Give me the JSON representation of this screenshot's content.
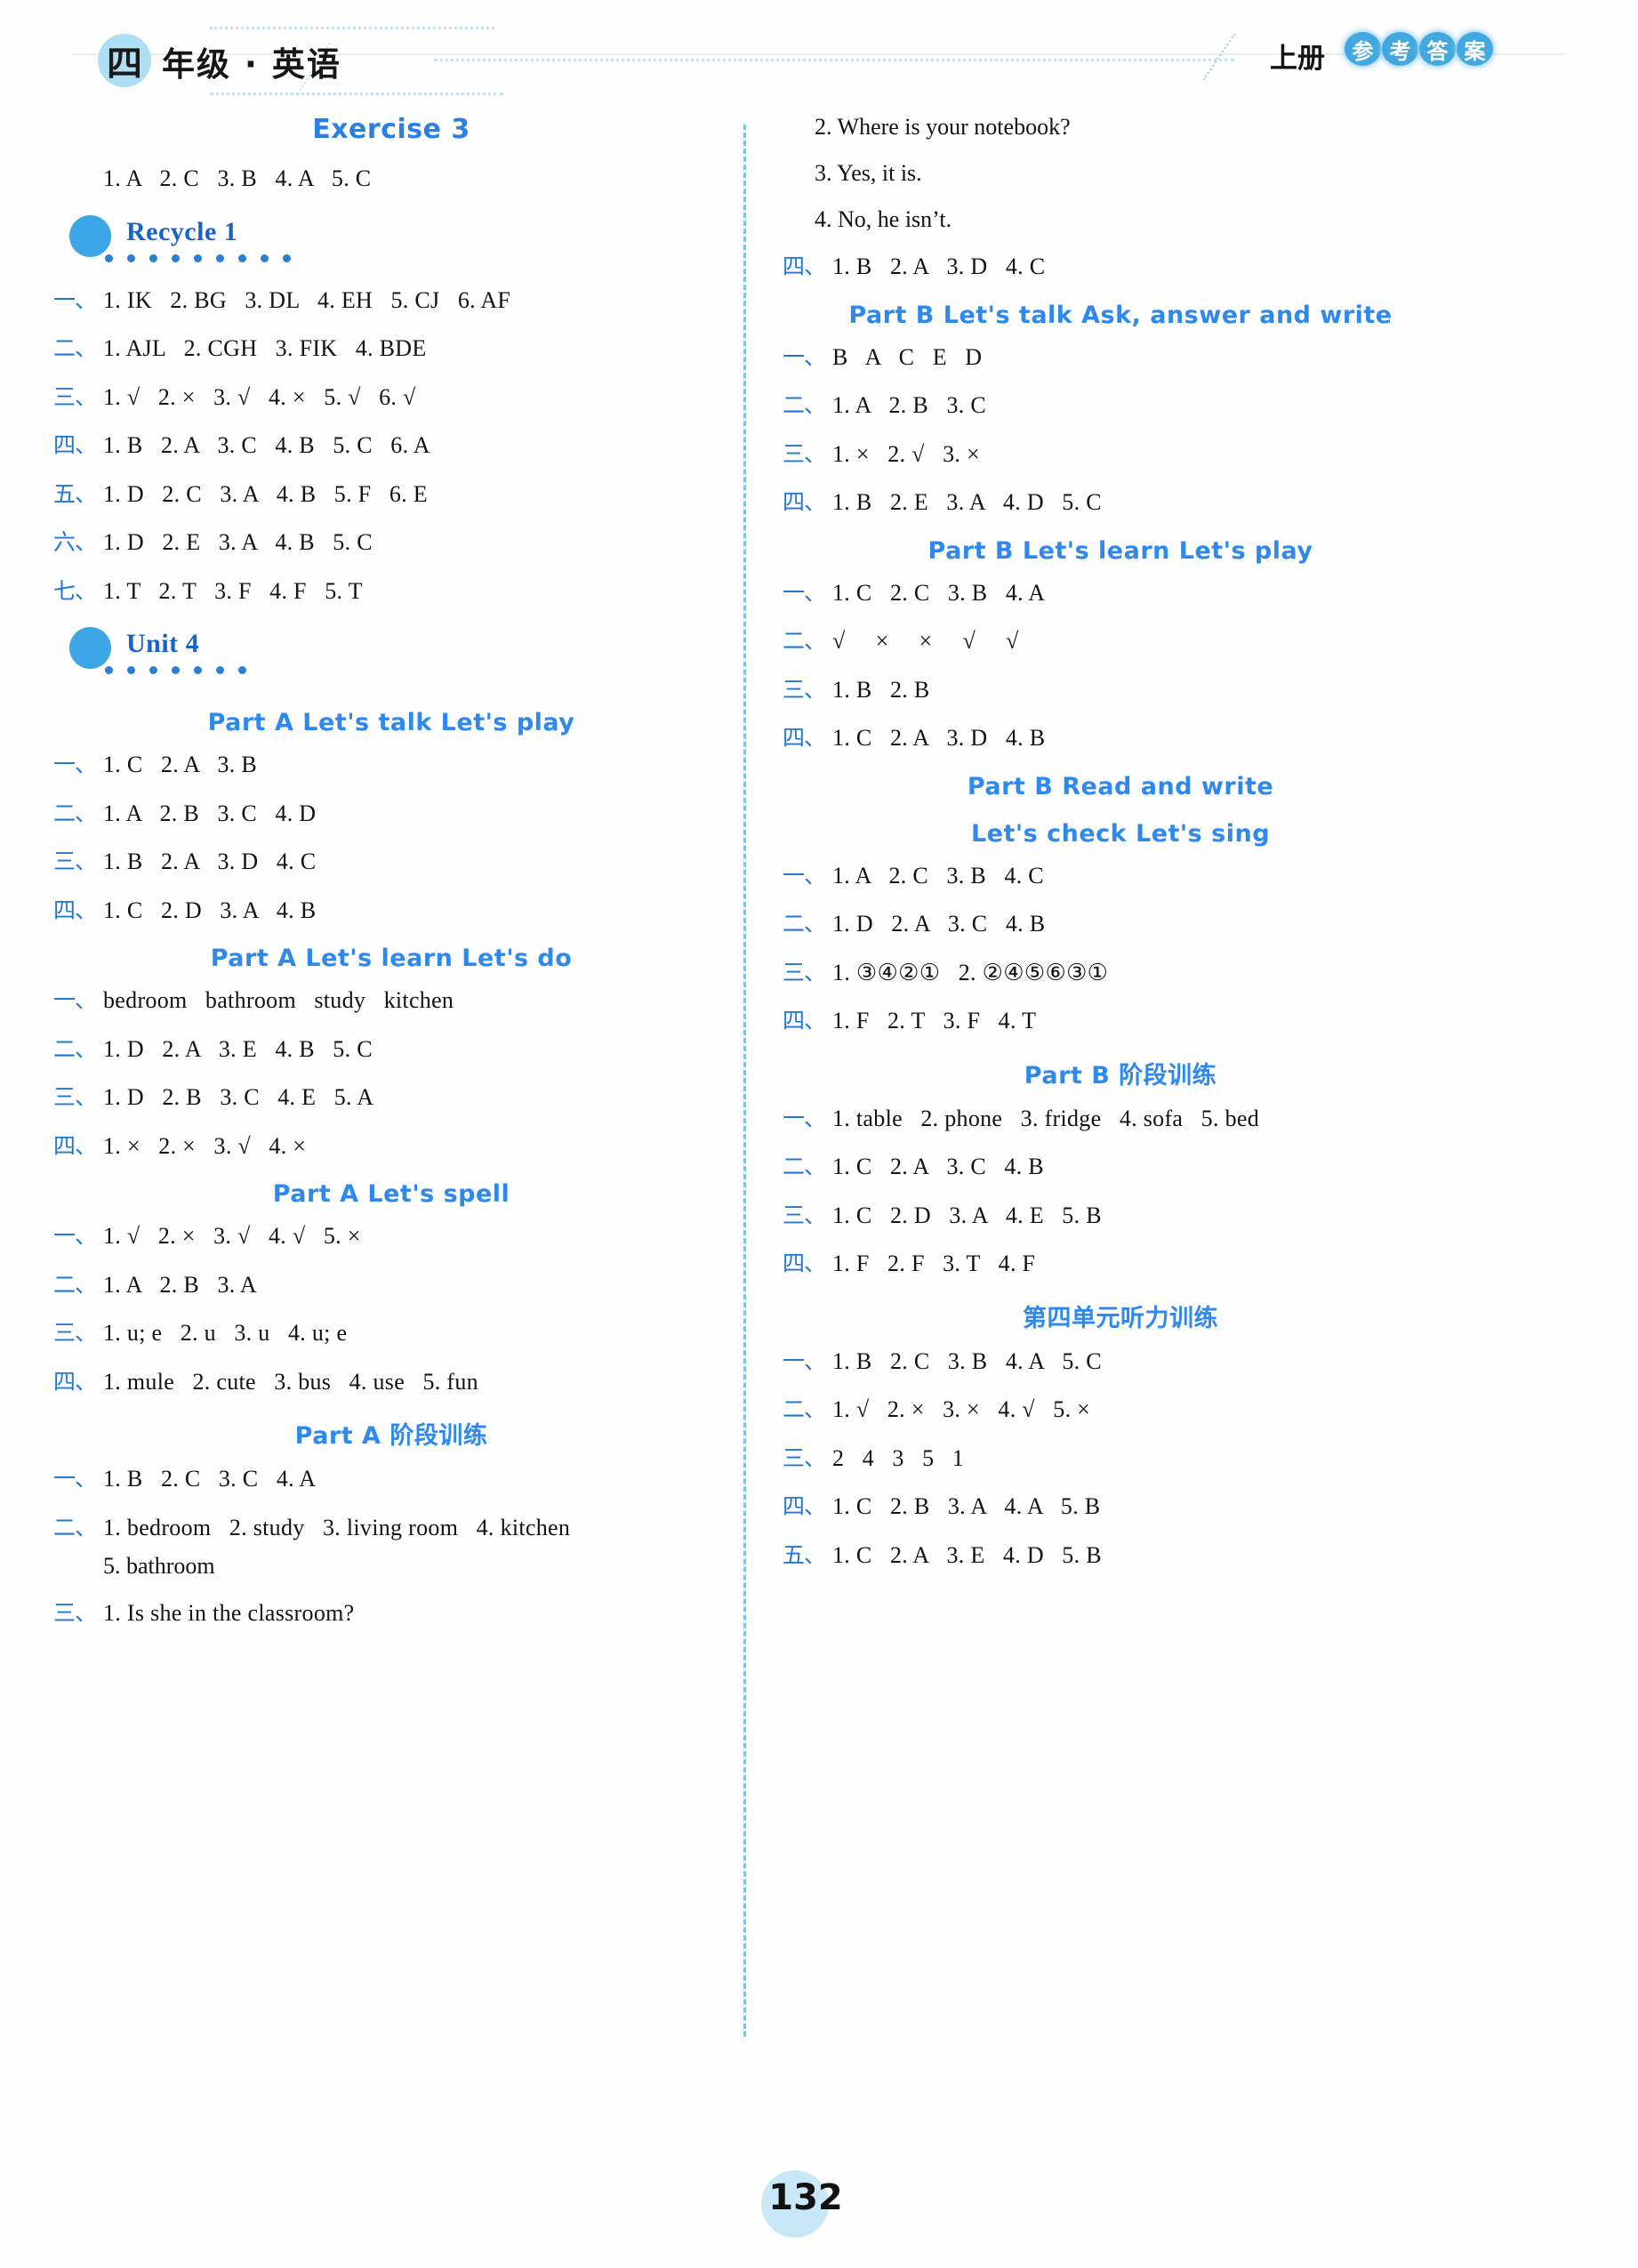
{
  "header": {
    "grade_char": "四",
    "grade_text": "年级 · 英语",
    "volume": "上册",
    "answer_badges": [
      "参",
      "考",
      "答",
      "案"
    ],
    "accent_color": "#2f89ec",
    "badge_color": "#44a8e0"
  },
  "page_number": "132",
  "left_column": [
    {
      "type": "exercise_heading",
      "text": "Exercise 3"
    },
    {
      "type": "row",
      "num": "",
      "ans": "1. A   2. C   3. B   4. A   5. C"
    },
    {
      "type": "unit",
      "label": "Recycle 1"
    },
    {
      "type": "row",
      "num": "一、",
      "ans": "1. IK   2. BG   3. DL   4. EH   5. CJ   6. AF"
    },
    {
      "type": "row",
      "num": "二、",
      "ans": "1. AJL   2. CGH   3. FIK   4. BDE"
    },
    {
      "type": "row",
      "num": "三、",
      "ans": "1. √   2. ×   3. √   4. ×   5. √   6. √"
    },
    {
      "type": "row",
      "num": "四、",
      "ans": "1. B   2. A   3. C   4. B   5. C   6. A"
    },
    {
      "type": "row",
      "num": "五、",
      "ans": "1. D   2. C   3. A   4. B   5. F   6. E"
    },
    {
      "type": "row",
      "num": "六、",
      "ans": "1. D   2. E   3. A   4. B   5. C"
    },
    {
      "type": "row",
      "num": "七、",
      "ans": "1. T   2. T   3. F   4. F   5. T"
    },
    {
      "type": "unit",
      "label": "Unit 4"
    },
    {
      "type": "part_heading",
      "text": "Part A   Let's talk   Let's play"
    },
    {
      "type": "row",
      "num": "一、",
      "ans": "1. C   2. A   3. B"
    },
    {
      "type": "row",
      "num": "二、",
      "ans": "1. A   2. B   3. C   4. D"
    },
    {
      "type": "row",
      "num": "三、",
      "ans": "1. B   2. A   3. D   4. C"
    },
    {
      "type": "row",
      "num": "四、",
      "ans": "1. C   2. D   3. A   4. B"
    },
    {
      "type": "part_heading",
      "text": "Part A   Let's learn   Let's do"
    },
    {
      "type": "row",
      "num": "一、",
      "ans": "bedroom   bathroom   study   kitchen"
    },
    {
      "type": "row",
      "num": "二、",
      "ans": "1. D   2. A   3. E   4. B   5. C"
    },
    {
      "type": "row",
      "num": "三、",
      "ans": "1. D   2. B   3. C   4. E   5. A"
    },
    {
      "type": "row",
      "num": "四、",
      "ans": "1. ×   2. ×   3. √   4. ×"
    },
    {
      "type": "part_heading",
      "text": "Part A   Let's spell"
    },
    {
      "type": "row",
      "num": "一、",
      "ans": "1. √   2. ×   3. √   4. √   5. ×"
    },
    {
      "type": "row",
      "num": "二、",
      "ans": "1. A   2. B   3. A"
    },
    {
      "type": "row",
      "num": "三、",
      "ans": "1. u; e   2. u   3. u   4. u; e"
    },
    {
      "type": "row",
      "num": "四、",
      "ans": "1. mule   2. cute   3. bus   4. use   5. fun"
    },
    {
      "type": "part_heading_cn",
      "text": "Part A 阶段训练"
    },
    {
      "type": "row",
      "num": "一、",
      "ans": "1. B   2. C   3. C   4. A"
    },
    {
      "type": "row",
      "num": "二、",
      "ans": "1. bedroom   2. study   3. living room   4. kitchen"
    },
    {
      "type": "continuation",
      "text": "5. bathroom"
    },
    {
      "type": "row",
      "num": "三、",
      "ans": "1. Is she in the classroom?"
    }
  ],
  "right_column": [
    {
      "type": "plain",
      "text": "2. Where is your notebook?"
    },
    {
      "type": "plain",
      "text": "3. Yes, it is."
    },
    {
      "type": "plain",
      "text": "4. No, he isn’t."
    },
    {
      "type": "row",
      "num": "四、",
      "ans": "1. B   2. A   3. D   4. C"
    },
    {
      "type": "part_heading",
      "text": "Part B   Let's talk   Ask, answer and write"
    },
    {
      "type": "row",
      "num": "一、",
      "ans": "B   A   C   E   D"
    },
    {
      "type": "row",
      "num": "二、",
      "ans": "1. A   2. B   3. C"
    },
    {
      "type": "row",
      "num": "三、",
      "ans": "1. ×   2. √   3. ×"
    },
    {
      "type": "row",
      "num": "四、",
      "ans": "1. B   2. E   3. A   4. D   5. C"
    },
    {
      "type": "part_heading",
      "text": "Part B   Let's learn   Let's play"
    },
    {
      "type": "row",
      "num": "一、",
      "ans": "1. C   2. C   3. B   4. A"
    },
    {
      "type": "row",
      "num": "二、",
      "ans": "√     ×     ×     √     √"
    },
    {
      "type": "row",
      "num": "三、",
      "ans": "1. B   2. B"
    },
    {
      "type": "row",
      "num": "四、",
      "ans": "1. C   2. A   3. D   4. B"
    },
    {
      "type": "part_heading",
      "text": "Part B   Read and write"
    },
    {
      "type": "part_heading",
      "text": "Let's check   Let's sing"
    },
    {
      "type": "row",
      "num": "一、",
      "ans": "1. A   2. C   3. B   4. C"
    },
    {
      "type": "row",
      "num": "二、",
      "ans": "1. D   2. A   3. C   4. B"
    },
    {
      "type": "row",
      "num": "三、",
      "ans": "1. ③④②①   2. ②④⑤⑥③①"
    },
    {
      "type": "row",
      "num": "四、",
      "ans": "1. F   2. T   3. F   4. T"
    },
    {
      "type": "part_heading_cn",
      "text": "Part B 阶段训练"
    },
    {
      "type": "row",
      "num": "一、",
      "ans": "1. table   2. phone   3. fridge   4. sofa   5. bed"
    },
    {
      "type": "row",
      "num": "二、",
      "ans": "1. C   2. A   3. C   4. B"
    },
    {
      "type": "row",
      "num": "三、",
      "ans": "1. C   2. D   3. A   4. E   5. B"
    },
    {
      "type": "row",
      "num": "四、",
      "ans": "1. F   2. F   3. T   4. F"
    },
    {
      "type": "part_heading_cn",
      "text": "第四单元听力训练"
    },
    {
      "type": "row",
      "num": "一、",
      "ans": "1. B   2. C   3. B   4. A   5. C"
    },
    {
      "type": "row",
      "num": "二、",
      "ans": "1. √   2. ×   3. ×   4. √   5. ×"
    },
    {
      "type": "row",
      "num": "三、",
      "ans": "2   4   3   5   1"
    },
    {
      "type": "row",
      "num": "四、",
      "ans": "1. C   2. B   3. A   4. A   5. B"
    },
    {
      "type": "row",
      "num": "五、",
      "ans": "1. C   2. A   3. E   4. D   5. B"
    }
  ]
}
